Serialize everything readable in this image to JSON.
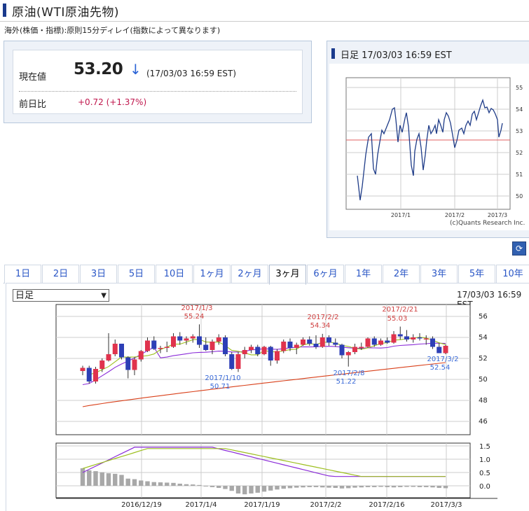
{
  "header": {
    "title": "原油(WTI原油先物)"
  },
  "note": "海外(株価・指標):原則15分ディレイ(指数によって異なります)",
  "quote": {
    "price_label": "現在値",
    "price": "53.20",
    "direction_icon": "down-arrow-icon",
    "time": "(17/03/03 16:59 EST)",
    "change_label": "前日比",
    "change": "+0.72 (+1.37%)"
  },
  "intraday": {
    "title": "日足 17/03/03 16:59 EST",
    "credit": "(c)Quants Research Inc.",
    "yticks": [
      "55",
      "54",
      "53",
      "52",
      "51",
      "50"
    ],
    "xticks": [
      "2017/1",
      "2017/2",
      "2017/3"
    ]
  },
  "tabs": [
    "1日",
    "2日",
    "3日",
    "5日",
    "10日",
    "1ヶ月",
    "2ヶ月",
    "3ヶ月",
    "6ヶ月",
    "1年",
    "2年",
    "3年",
    "5年",
    "10年"
  ],
  "active_tab": "3ヶ月",
  "chart": {
    "interval": "日足",
    "time": "17/03/03 16:59 EST",
    "yticks": [
      "56",
      "54",
      "52",
      "50",
      "48",
      "46"
    ],
    "osc_yticks": [
      "1.5",
      "1.0",
      "0.5",
      "0.0"
    ],
    "xticks": [
      "2016/12/19",
      "2017/1/4",
      "2017/1/19",
      "2017/2/2",
      "2017/2/16",
      "2017/3/3"
    ],
    "annotations": [
      {
        "date": "2017/1/3",
        "value": "55.24",
        "color": "#d04040"
      },
      {
        "date": "2017/2/2",
        "value": "54.34",
        "color": "#d04040"
      },
      {
        "date": "2017/2/21",
        "value": "55.03",
        "color": "#d04040"
      },
      {
        "date": "2017/1/10",
        "value": "50.71",
        "color": "#3a6ad8"
      },
      {
        "date": "2017/2/8",
        "value": "51.22",
        "color": "#3a6ad8"
      },
      {
        "date": "2017/3/2",
        "value": "52.54",
        "color": "#3a6ad8"
      }
    ]
  },
  "chart_data": [
    {
      "type": "candlestick",
      "title": "日足",
      "ylim": [
        45,
        57
      ],
      "ma_series": [
        {
          "color": "#9dbf1f"
        },
        {
          "color": "#8a2bd8"
        },
        {
          "color": "#d9401a"
        }
      ],
      "candles": [
        [
          50.8,
          51.3,
          50.4,
          51.1
        ],
        [
          51.1,
          51.3,
          49.6,
          49.8
        ],
        [
          49.8,
          51.2,
          49.6,
          51.0
        ],
        [
          51.0,
          52.0,
          50.7,
          51.8
        ],
        [
          51.8,
          54.4,
          51.7,
          52.4
        ],
        [
          52.4,
          53.8,
          52.2,
          53.4
        ],
        [
          53.4,
          53.4,
          51.9,
          52.1
        ],
        [
          52.1,
          52.2,
          50.1,
          50.9
        ],
        [
          50.9,
          52.1,
          50.4,
          51.9
        ],
        [
          51.9,
          52.8,
          51.7,
          52.7
        ],
        [
          52.7,
          54.0,
          52.6,
          53.7
        ],
        [
          53.7,
          54.1,
          52.8,
          52.9
        ],
        [
          52.9,
          53.2,
          52.5,
          53.0
        ],
        [
          53.0,
          53.6,
          52.6,
          53.1
        ],
        [
          53.1,
          54.4,
          53.0,
          54.1
        ],
        [
          54.1,
          54.5,
          53.3,
          53.7
        ],
        [
          53.7,
          54.1,
          53.3,
          53.9
        ],
        [
          53.9,
          54.3,
          53.5,
          54.1
        ],
        [
          54.1,
          55.24,
          53.0,
          53.3
        ],
        [
          53.3,
          54.0,
          52.7,
          52.8
        ],
        [
          52.8,
          53.8,
          52.4,
          53.6
        ],
        [
          53.6,
          54.3,
          53.3,
          54.0
        ],
        [
          54.0,
          54.2,
          52.2,
          52.4
        ],
        [
          52.4,
          52.6,
          50.9,
          51.0
        ],
        [
          51.0,
          52.6,
          50.71,
          52.4
        ],
        [
          52.4,
          53.1,
          52.0,
          52.8
        ],
        [
          52.8,
          53.3,
          52.5,
          53.1
        ],
        [
          53.1,
          53.3,
          52.2,
          52.4
        ],
        [
          52.4,
          53.2,
          52.3,
          53.1
        ],
        [
          53.1,
          53.2,
          51.3,
          51.8
        ],
        [
          51.8,
          52.9,
          51.5,
          52.7
        ],
        [
          52.7,
          53.8,
          52.5,
          53.6
        ],
        [
          53.6,
          53.9,
          52.7,
          53.0
        ],
        [
          53.0,
          53.5,
          52.4,
          53.3
        ],
        [
          53.3,
          54.0,
          53.2,
          53.8
        ],
        [
          53.8,
          54.1,
          53.2,
          53.4
        ],
        [
          53.4,
          54.2,
          52.9,
          53.1
        ],
        [
          53.1,
          54.34,
          53.0,
          54.0
        ],
        [
          54.0,
          54.2,
          53.2,
          53.5
        ],
        [
          53.5,
          53.9,
          53.1,
          53.3
        ],
        [
          53.3,
          53.4,
          52.0,
          52.3
        ],
        [
          52.3,
          52.7,
          51.22,
          52.6
        ],
        [
          52.6,
          53.4,
          52.4,
          53.1
        ],
        [
          53.1,
          53.5,
          52.8,
          53.1
        ],
        [
          53.1,
          54.0,
          53.0,
          53.9
        ],
        [
          53.9,
          54.1,
          53.1,
          53.3
        ],
        [
          53.3,
          53.9,
          53.2,
          53.7
        ],
        [
          53.7,
          54.0,
          53.4,
          53.5
        ],
        [
          53.5,
          54.6,
          53.4,
          54.3
        ],
        [
          54.3,
          55.03,
          53.8,
          54.1
        ],
        [
          54.1,
          54.7,
          53.6,
          53.8
        ],
        [
          53.8,
          54.3,
          53.5,
          54.0
        ],
        [
          54.0,
          54.4,
          53.7,
          53.9
        ],
        [
          53.9,
          54.2,
          53.3,
          53.9
        ],
        [
          53.9,
          54.1,
          52.9,
          53.1
        ],
        [
          53.1,
          53.5,
          52.54,
          52.5
        ],
        [
          52.5,
          53.3,
          52.4,
          53.2
        ]
      ]
    },
    {
      "type": "bar",
      "title": "oscillator",
      "ylim": [
        -0.4,
        1.5
      ],
      "values": [
        0.66,
        0.58,
        0.55,
        0.51,
        0.47,
        0.45,
        0.41,
        0.27,
        0.25,
        0.2,
        0.17,
        0.14,
        0.13,
        0.12,
        0.11,
        0.08,
        0.06,
        0.05,
        0.03,
        -0.02,
        -0.05,
        -0.08,
        -0.12,
        -0.19,
        -0.29,
        -0.32,
        -0.29,
        -0.26,
        -0.22,
        -0.18,
        -0.14,
        -0.11,
        -0.09,
        -0.07,
        -0.06,
        -0.05,
        -0.05,
        -0.06,
        -0.07,
        -0.08,
        -0.1,
        -0.09,
        -0.07,
        -0.06,
        -0.05,
        -0.05,
        -0.04,
        -0.05,
        -0.06,
        -0.05,
        -0.04,
        -0.04,
        -0.05,
        -0.05,
        -0.06,
        -0.08,
        -0.09
      ]
    }
  ]
}
